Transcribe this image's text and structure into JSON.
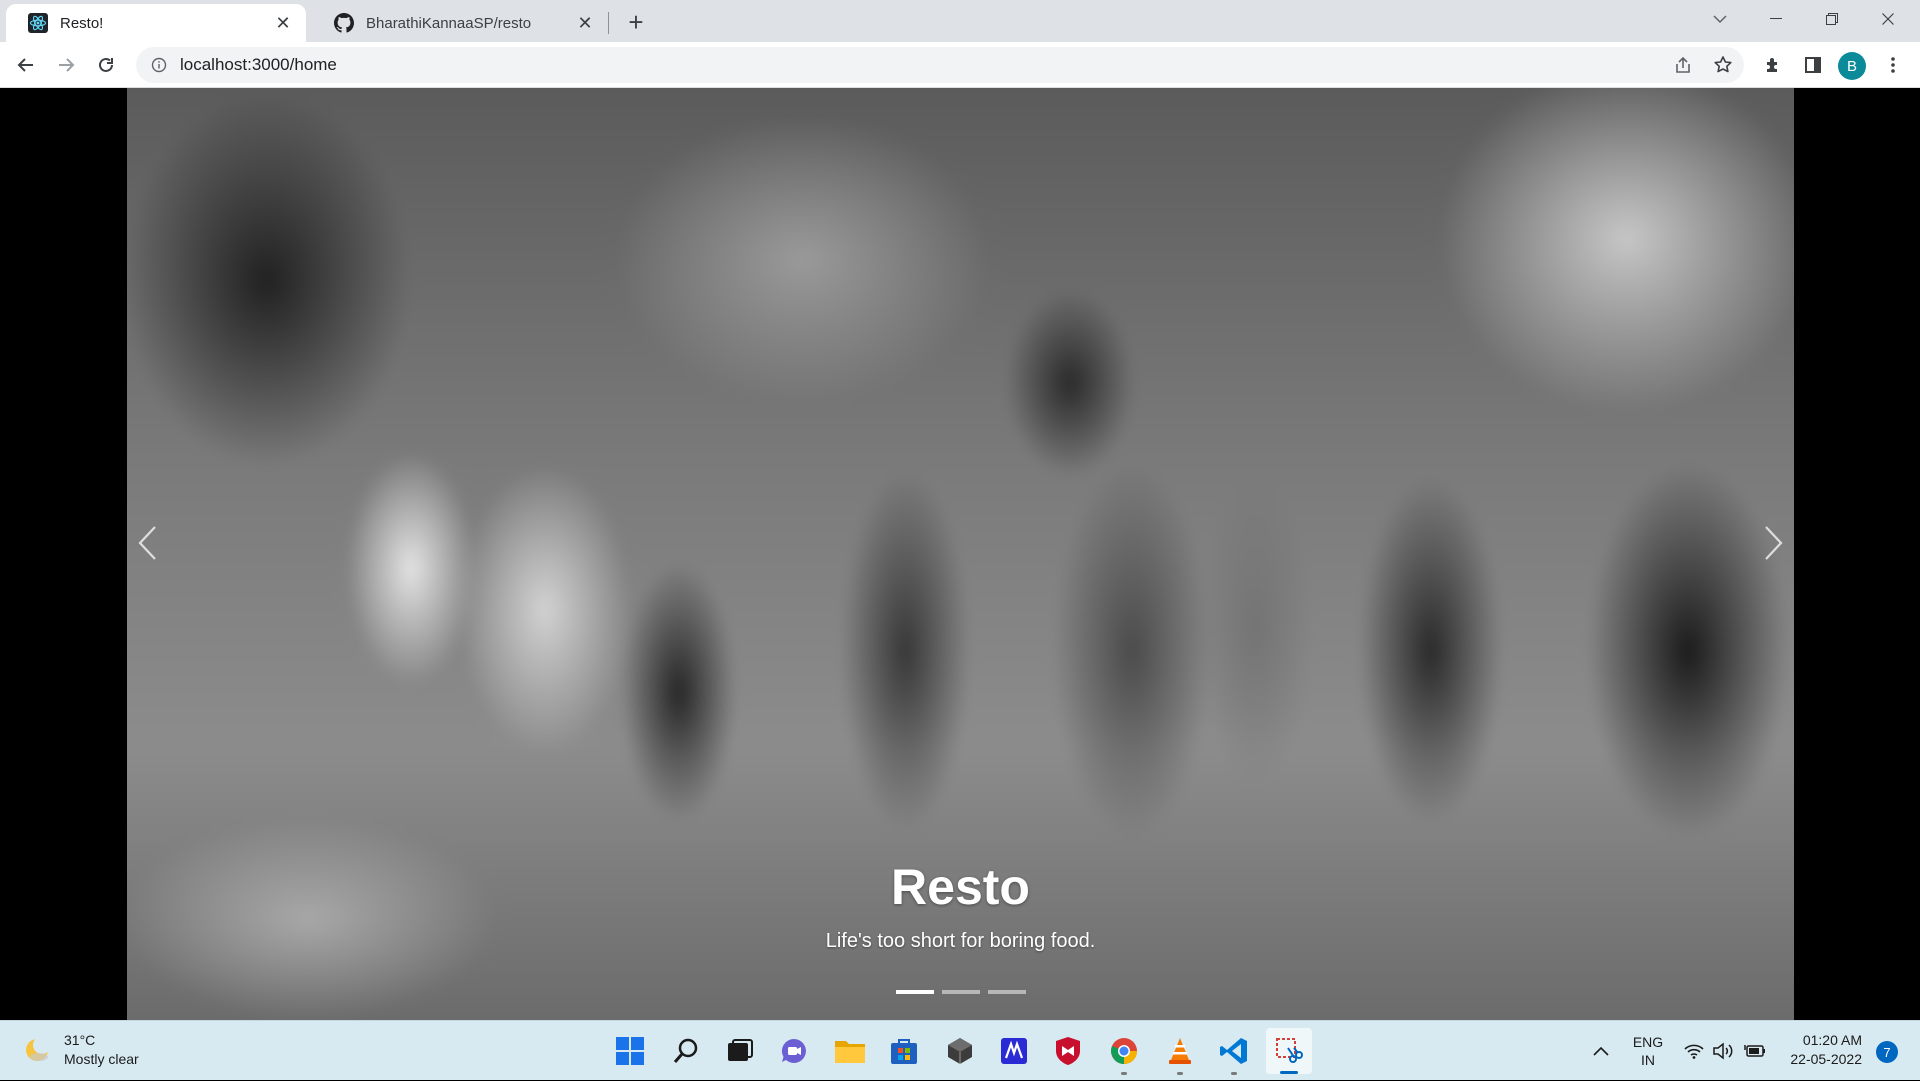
{
  "browser": {
    "tabs": [
      {
        "title": "Resto!",
        "favicon": "react-icon",
        "active": true
      },
      {
        "title": "BharathiKannaaSP/resto",
        "favicon": "github-icon",
        "active": false
      }
    ],
    "url": "localhost:3000/home",
    "profile_initial": "B"
  },
  "page": {
    "carousel": {
      "title": "Resto",
      "subtitle": "Life's too short for boring food.",
      "indicator_count": 3,
      "active_index": 0
    }
  },
  "taskbar": {
    "weather": {
      "temp": "31°C",
      "condition": "Mostly clear"
    },
    "apps": [
      "windows-start-icon",
      "search-icon",
      "task-view-icon",
      "teams-chat-icon",
      "file-explorer-icon",
      "microsoft-store-icon",
      "app-cube-icon",
      "app-m-icon",
      "mcafee-icon",
      "chrome-icon",
      "vlc-icon",
      "vscode-icon",
      "snipping-tool-icon"
    ],
    "language": {
      "line1": "ENG",
      "line2": "IN"
    },
    "time": "01:20 AM",
    "date": "22-05-2022",
    "notification_count": "7"
  },
  "colors": {
    "profile": "#0b8a9a",
    "accent": "#0067c0",
    "taskbar": "#d8eaf1"
  }
}
